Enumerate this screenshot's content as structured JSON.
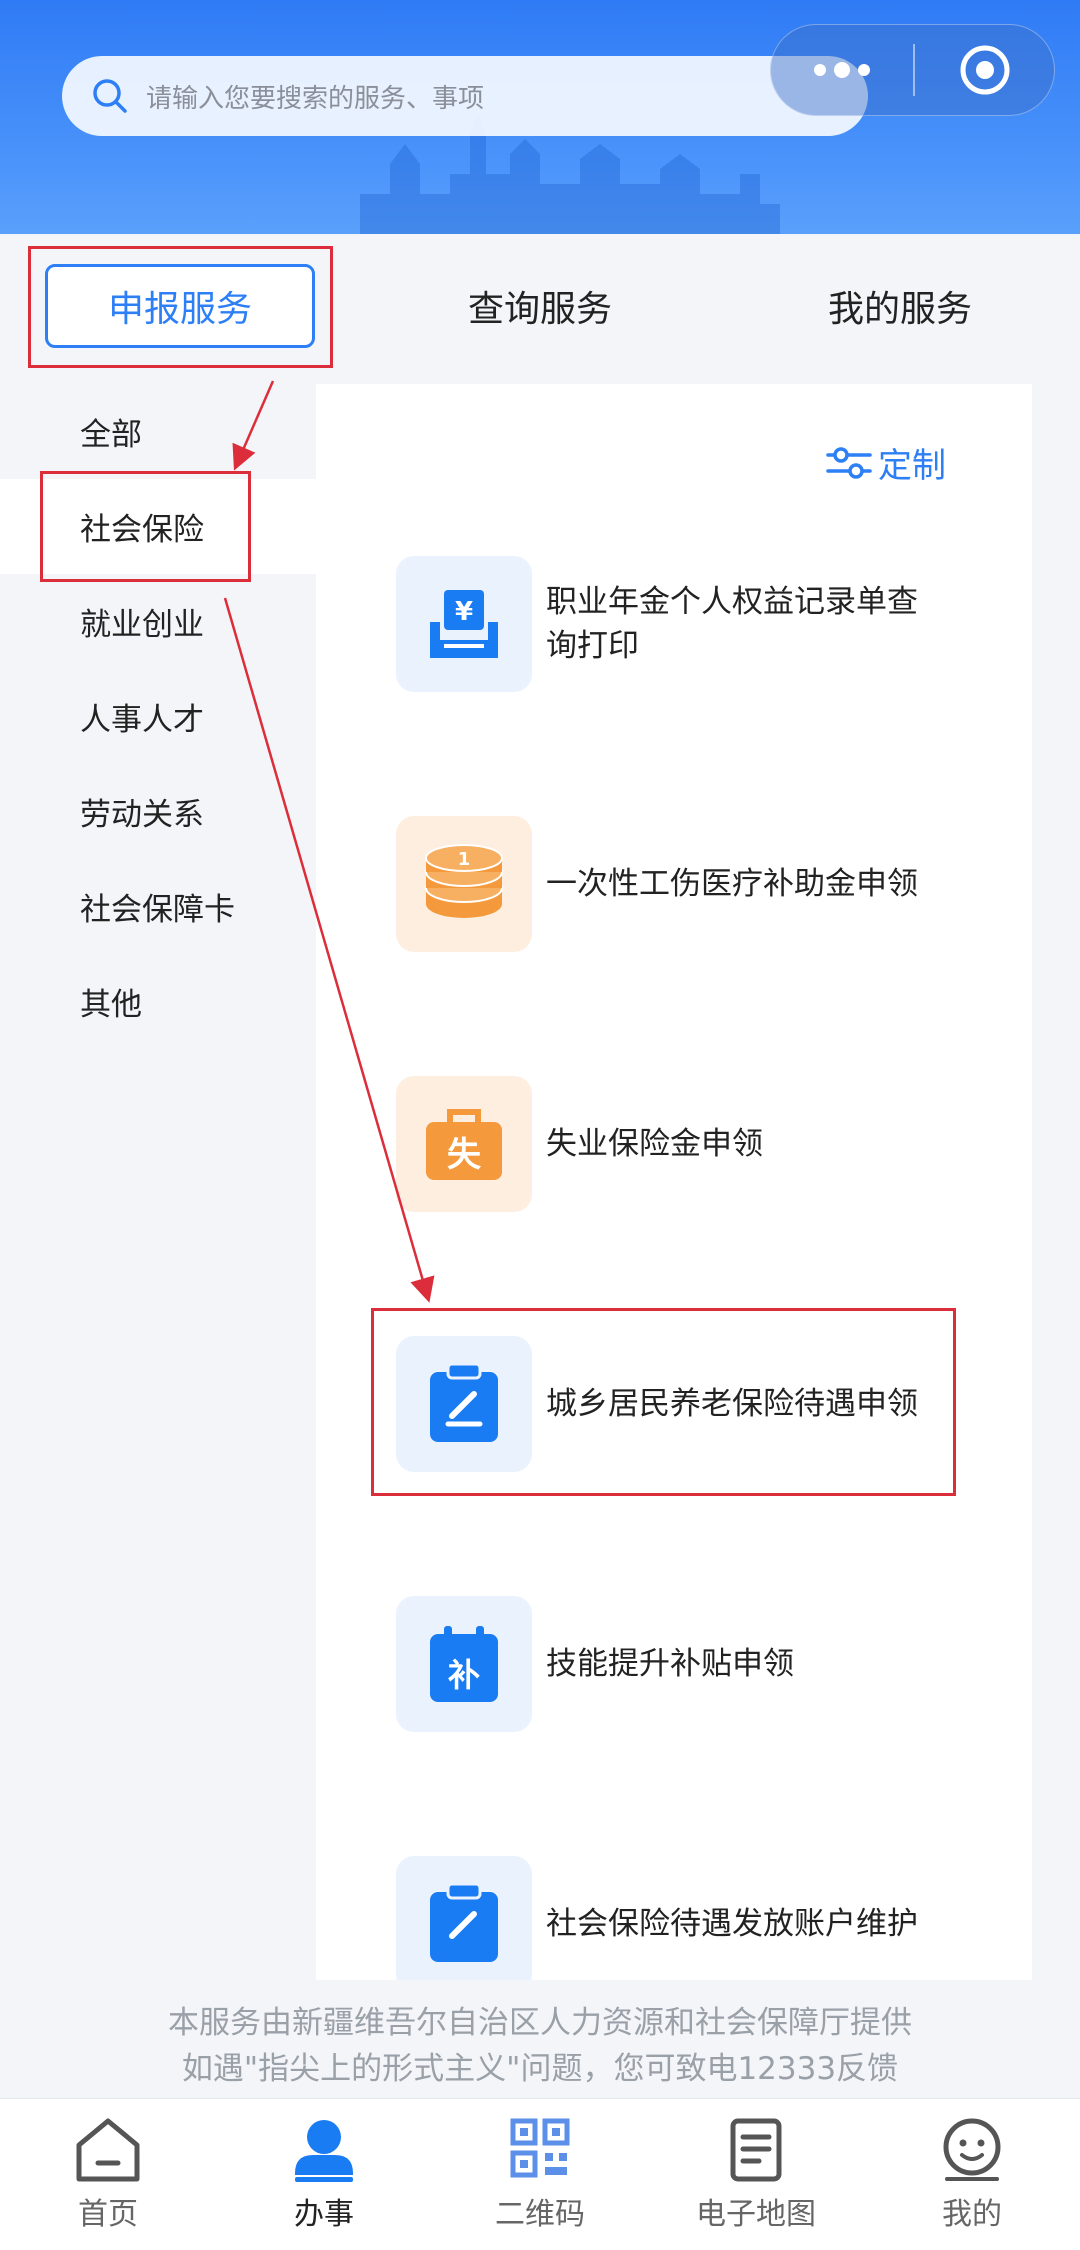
{
  "search": {
    "placeholder": "请输入您要搜索的服务、事项"
  },
  "tabs": [
    {
      "label": "申报服务",
      "active": true
    },
    {
      "label": "查询服务"
    },
    {
      "label": "我的服务"
    }
  ],
  "categories": [
    {
      "label": "全部"
    },
    {
      "label": "社会保险",
      "active": true
    },
    {
      "label": "就业创业"
    },
    {
      "label": "人事人才"
    },
    {
      "label": "劳动关系"
    },
    {
      "label": "社会保障卡"
    },
    {
      "label": "其他"
    }
  ],
  "custom_label": "定制",
  "services": [
    {
      "name": "职业年金个人权益记录单查询打印",
      "icon": "yuan-tray-icon"
    },
    {
      "name": "一次性工伤医疗补助金申领",
      "icon": "coins-icon"
    },
    {
      "name": "失业保险金申领",
      "icon": "briefcase-icon",
      "icon_char": "失"
    },
    {
      "name": "城乡居民养老保险待遇申领",
      "icon": "clipboard-pen-icon"
    },
    {
      "name": "技能提升补贴申领",
      "icon": "calendar-icon",
      "icon_char": "补"
    },
    {
      "name": "社会保险待遇发放账户维护",
      "icon": "clipboard-pen-icon"
    }
  ],
  "footer": {
    "line1": "本服务由新疆维吾尔自治区人力资源和社会保障厅提供",
    "line2": "如遇\"指尖上的形式主义\"问题，您可致电12333反馈"
  },
  "nav": [
    {
      "label": "首页",
      "icon": "home-icon"
    },
    {
      "label": "办事",
      "icon": "person-icon",
      "active": true
    },
    {
      "label": "二维码",
      "icon": "qr-code-icon"
    },
    {
      "label": "电子地图",
      "icon": "document-icon"
    },
    {
      "label": "我的",
      "icon": "face-icon"
    }
  ],
  "colors": {
    "primary": "#2d7ff5",
    "orange": "#f59a3c",
    "annotation": "#dc2d3a"
  }
}
